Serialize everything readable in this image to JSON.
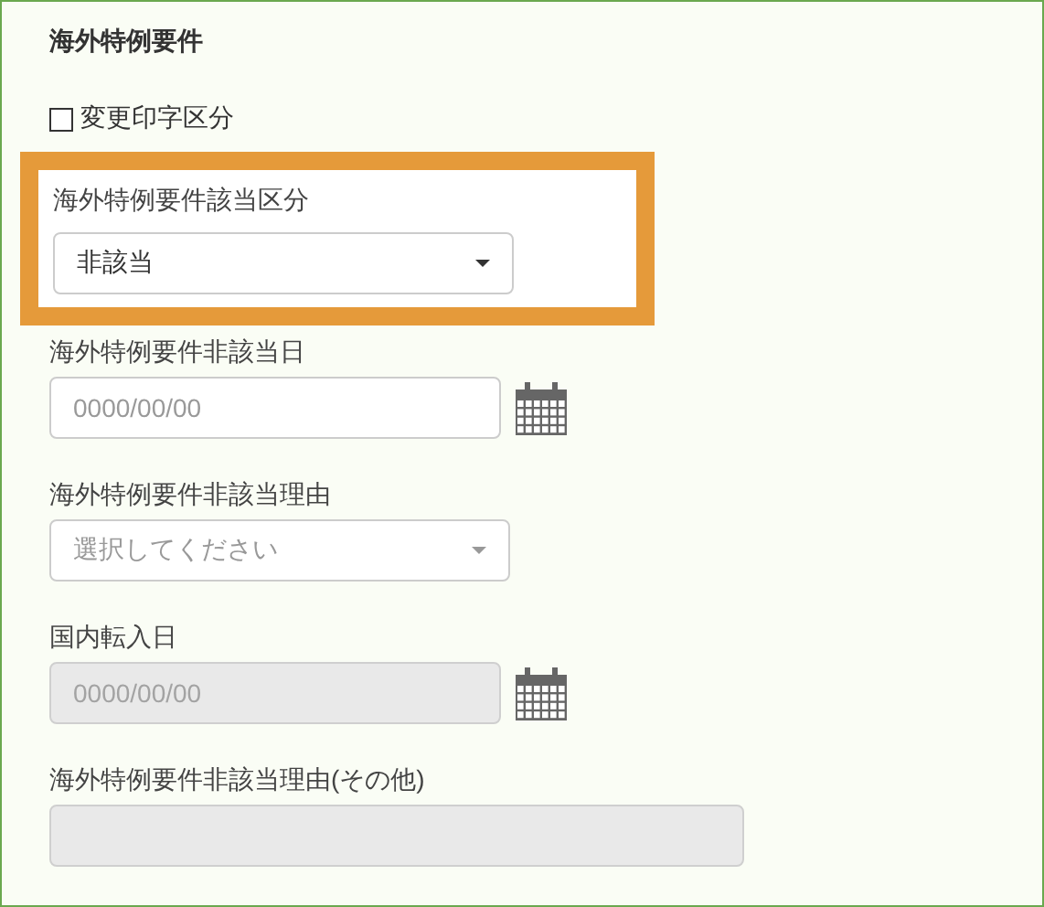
{
  "section": {
    "title": "海外特例要件"
  },
  "checkbox": {
    "label": "変更印字区分",
    "checked": false
  },
  "fields": [
    {
      "kind": "select",
      "label": "海外特例要件該当区分",
      "value": "非該当",
      "disabled": false,
      "highlighted": true
    },
    {
      "kind": "date",
      "label": "海外特例要件非該当日",
      "placeholder": "0000/00/00",
      "disabled": false,
      "highlighted": false
    },
    {
      "kind": "select",
      "label": "海外特例要件非該当理由",
      "placeholder": "選択してください",
      "disabled": false,
      "highlighted": false
    },
    {
      "kind": "date",
      "label": "国内転入日",
      "placeholder": "0000/00/00",
      "disabled": true,
      "highlighted": false
    },
    {
      "kind": "text",
      "label": "海外特例要件非該当理由(その他)",
      "disabled": true,
      "highlighted": false
    }
  ]
}
